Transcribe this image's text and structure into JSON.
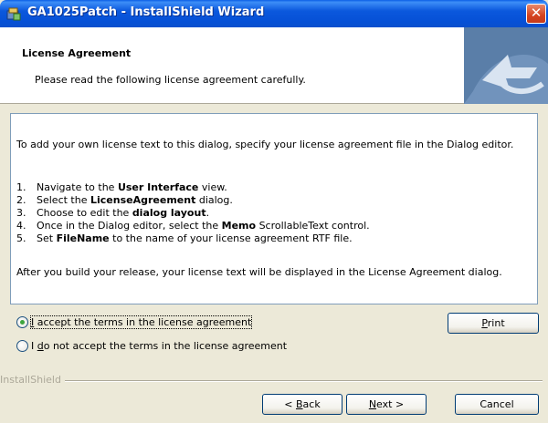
{
  "window": {
    "title": "GA1025Patch - InstallShield Wizard",
    "close_glyph": "✕",
    "icon": "installer-icon"
  },
  "header": {
    "title": "License Agreement",
    "subtitle": "Please read the following license agreement carefully."
  },
  "license": {
    "intro": "To add your own license text to this dialog, specify your license agreement file in the Dialog editor.",
    "steps": [
      {
        "num": "1.",
        "pre": "Navigate to the ",
        "bold": "User Interface",
        "post": " view."
      },
      {
        "num": "2.",
        "pre": "Select the ",
        "bold": "LicenseAgreement",
        "post": " dialog."
      },
      {
        "num": "3.",
        "pre": "Choose to edit the ",
        "bold": "dialog layout",
        "post": "."
      },
      {
        "num": "4.",
        "pre": "Once in the Dialog editor, select the ",
        "bold": "Memo",
        "post": " ScrollableText control."
      },
      {
        "num": "5.",
        "pre": "Set ",
        "bold": "FileName",
        "post": " to the name of your license agreement RTF file."
      }
    ],
    "outro": "After you build your release, your license text will be displayed in the License Agreement dialog."
  },
  "options": {
    "accept": {
      "pre": "",
      "mnemonic": "I",
      "post": " accept the terms in the license agreement",
      "checked": true
    },
    "decline": {
      "pre": "I ",
      "mnemonic": "d",
      "post": "o not accept the terms in the license agreement",
      "checked": false
    }
  },
  "buttons": {
    "print": {
      "pre": "",
      "mnemonic": "P",
      "post": "rint"
    },
    "back": {
      "pre": "< ",
      "mnemonic": "B",
      "post": "ack"
    },
    "next": {
      "pre": "",
      "mnemonic": "N",
      "post": "ext >"
    },
    "cancel": "Cancel"
  },
  "footer": {
    "brand": "InstallShield"
  },
  "colors": {
    "titlebar": "#0a58dd",
    "dialog_bg": "#ece9d8",
    "close": "#d5431f",
    "radio_check": "#3ea53e"
  }
}
